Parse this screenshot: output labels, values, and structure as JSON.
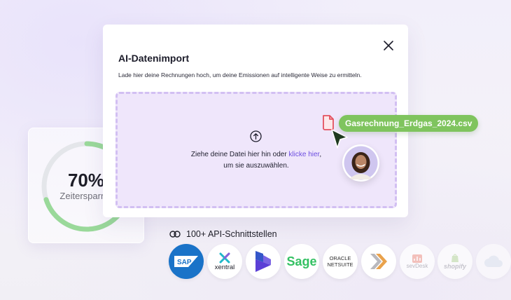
{
  "modal": {
    "title": "AI-Datenimport",
    "subtitle": "Lade hier deine Rechnungen hoch, um deine Emissionen auf intelligente Weise zu ermitteln.",
    "close_icon": "close-icon"
  },
  "dropzone": {
    "text_before_link": "Ziehe deine Datei hier hin oder ",
    "link_text": "klicke hier",
    "text_after_link": ",",
    "line2": "um sie auszuwählen.",
    "icon": "upload-arrow-icon"
  },
  "file": {
    "name": "Gasrechnung_Erdgas_2024.csv",
    "icon": "file-icon"
  },
  "savings": {
    "percent_label": "70%",
    "percent_value": 0.7,
    "label": "Zeitersparnis"
  },
  "api": {
    "title": "100+ API-Schnittstellen",
    "icon": "link-icon",
    "logos": [
      {
        "name": "SAP"
      },
      {
        "name": "xentral"
      },
      {
        "name": "Dynamics"
      },
      {
        "name": "Sage"
      },
      {
        "name": "ORACLE NETSUITE"
      },
      {
        "name": "Xero"
      },
      {
        "name": "sevDesk"
      },
      {
        "name": "shopify"
      },
      {
        "name": "cloud"
      }
    ]
  },
  "colors": {
    "accent_green": "#7fc45e",
    "link_purple": "#6d4ee0",
    "dropzone_bg": "#efe6fb",
    "cursor": "#1f3a1f",
    "sap_blue": "#1a73c8"
  }
}
